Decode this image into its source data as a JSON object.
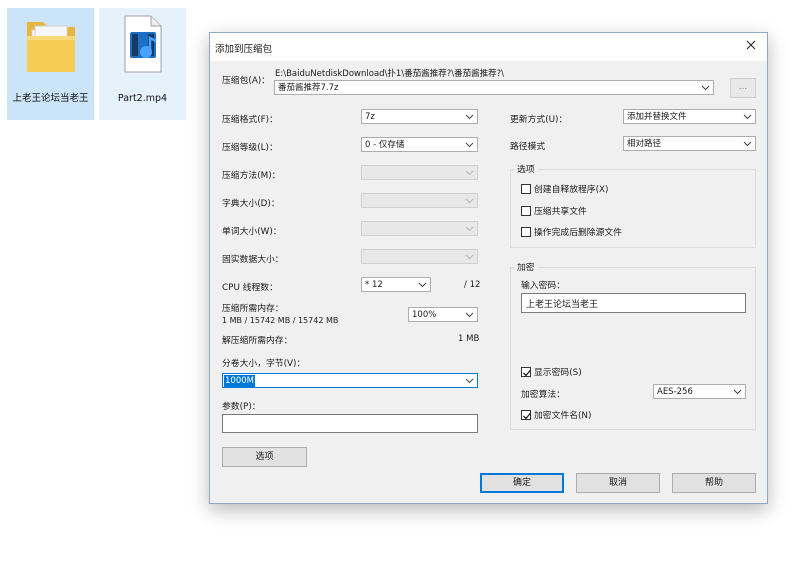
{
  "desktop": {
    "icons": [
      {
        "label": "上老王论坛当老王",
        "icon": "folder-icon"
      },
      {
        "label": "Part2.mp4",
        "icon": "video-file-icon"
      }
    ]
  },
  "dialog": {
    "title": "添加到压缩包",
    "archive": {
      "label": "压缩包(A)：",
      "path": "E:\\BaiduNetdiskDownload\\扑1\\番茄酱推荐?\\番茄酱推荐?\\",
      "filename": "番茄酱推荐7.7z",
      "browse_label": "..."
    },
    "left": {
      "format_label": "压缩格式(F)：",
      "format_value": "7z",
      "level_label": "压缩等级(L)：",
      "level_value": "0 - 仅存储",
      "method_label": "压缩方法(M)：",
      "dict_label": "字典大小(D)：",
      "word_label": "单词大小(W)：",
      "solid_label": "固实数据大小：",
      "cpu_label": "CPU 线程数：",
      "cpu_value": "* 12",
      "cpu_max": "/ 12",
      "mem_comp_label": "压缩所需内存：",
      "mem_comp_detail": "1 MB / 15742 MB / 15742 MB",
      "mem_percent": "100%",
      "mem_decomp_label": "解压缩所需内存：",
      "mem_decomp_value": "1 MB",
      "volume_label": "分卷大小，字节(V)：",
      "volume_value": "1000M",
      "params_label": "参数(P)：",
      "params_value": "",
      "options_button": "选项"
    },
    "right": {
      "update_label": "更新方式(U)：",
      "update_value": "添加并替换文件",
      "path_label": "路径模式",
      "path_value": "相对路径",
      "options_group": "选项",
      "opt_sfx": "创建自释放程序(X)",
      "opt_shared": "压缩共享文件",
      "opt_delete": "操作完成后删除源文件",
      "encrypt_group": "加密",
      "password_label": "输入密码：",
      "password_value": "上老王论坛当老王",
      "show_password": "显示密码(S)",
      "enc_method_label": "加密算法：",
      "enc_method_value": "AES-256",
      "encrypt_names": "加密文件名(N)"
    },
    "buttons": {
      "ok": "确定",
      "cancel": "取消",
      "help": "帮助"
    }
  }
}
